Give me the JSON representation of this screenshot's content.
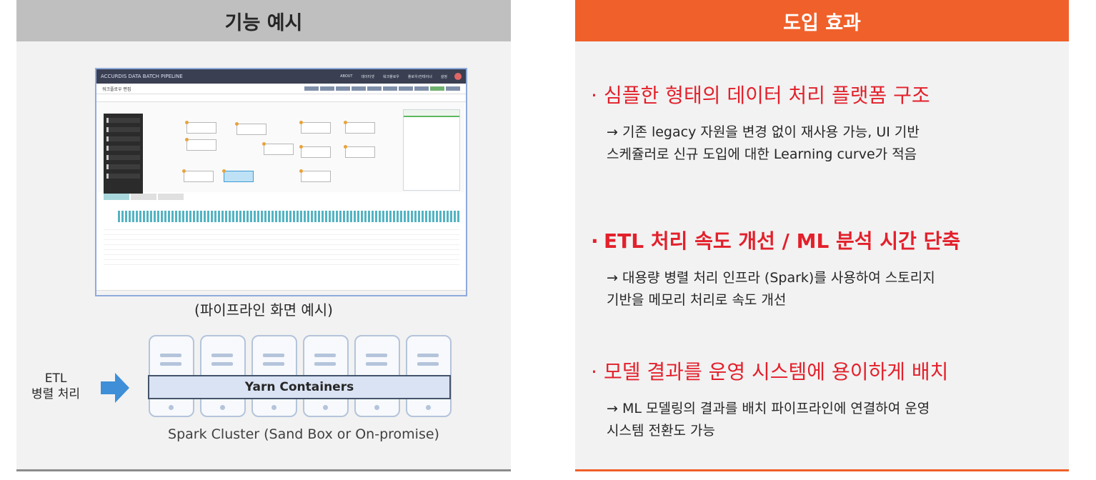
{
  "left": {
    "header": "기능 예시",
    "caption": "(파이프라인 화면 예시)",
    "etl_label_line1": "ETL",
    "etl_label_line2": "병렬 처리",
    "yarn_label": "Yarn Containers",
    "cluster_label": "Spark Cluster (Sand Box or On-promise)",
    "screenshot": {
      "brand": "ACCURDIS DATA  BATCH PIPELINE",
      "page_title": "워크플로우 편집",
      "menu": [
        "ABOUT",
        "데이터셋",
        "워크플로우",
        "플로우/컨테이너",
        "설정"
      ]
    }
  },
  "right": {
    "header": "도입 효과",
    "items": [
      {
        "title": "심플한 형태의 데이터 처리 플랫폼 구조",
        "line1": "→ 기존 legacy 자원을 변경 없이 재사용 가능, UI 기반",
        "line2": "스케쥴러로 신규 도입에 대한 Learning curve가 적음"
      },
      {
        "title": "ETL 처리 속도 개선 / ML 분석 시간 단축",
        "line1": "→ 대용량 병렬 처리 인프라 (Spark)를 사용하여 스토리지",
        "line2": "기반을 메모리 처리로 속도 개선"
      },
      {
        "title": "모델 결과를 운영 시스템에 용이하게 배치",
        "line1": "→ ML 모델링의 결과를 배치 파이프라인에 연결하여 운영",
        "line2": "시스템 전환도 가능"
      }
    ]
  }
}
